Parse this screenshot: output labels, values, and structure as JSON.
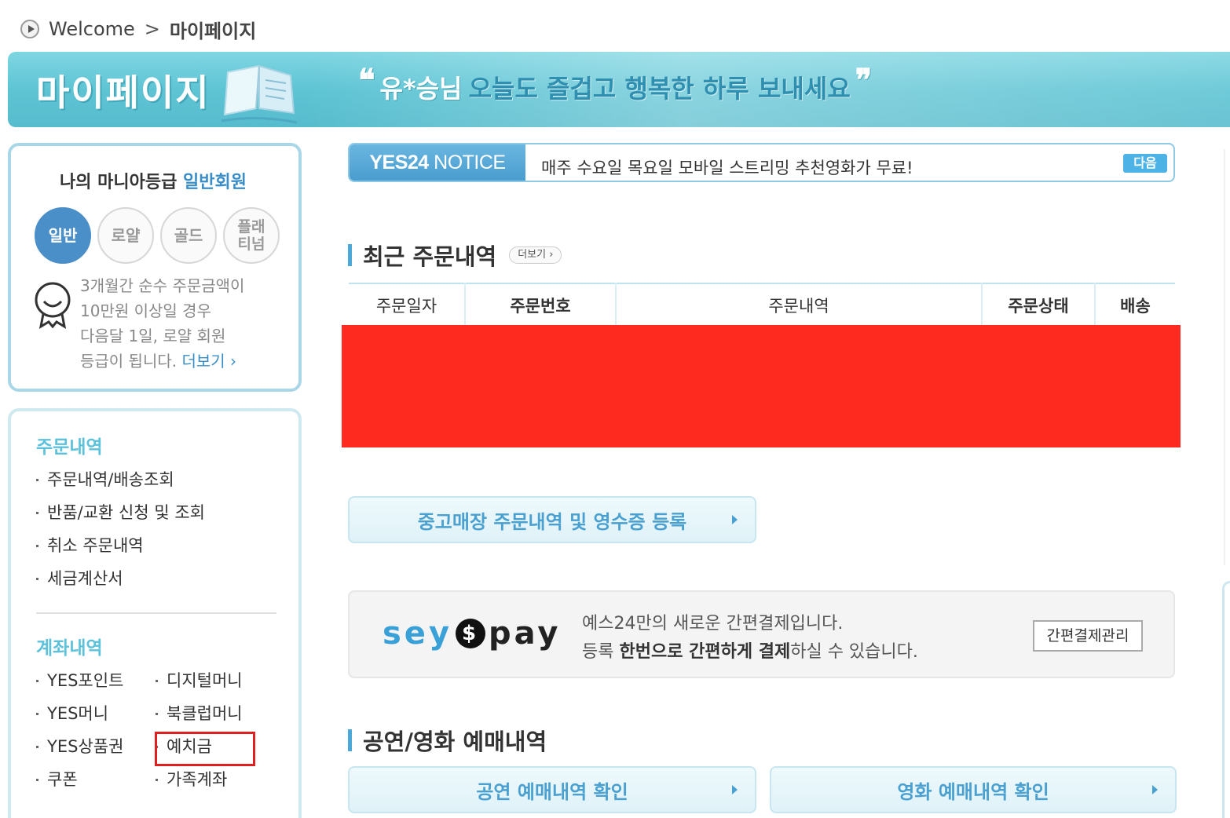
{
  "breadcrumb": {
    "home": "Welcome",
    "separator": ">",
    "current": "마이페이지"
  },
  "banner": {
    "title": "마이페이지",
    "quote_open": "❝",
    "quote_close": "❞",
    "user": "유*승님",
    "message": "오늘도 즐겁고 행복한 하루 보내세요"
  },
  "grade": {
    "title": "나의 마니아등급",
    "level": "일반회원",
    "levels": [
      "일반",
      "로얄",
      "골드",
      "플래\n티넘"
    ],
    "desc_lines": [
      "3개월간 순수 주문금액이",
      "10만원 이상일 경우",
      "다음달 1일, 로얄 회원",
      "등급이 됩니다."
    ],
    "more": "더보기 ›"
  },
  "menu": {
    "orders_title": "주문내역",
    "orders": [
      "주문내역/배송조회",
      "반품/교환 신청 및 조회",
      "취소 주문내역",
      "세금계산서"
    ],
    "accounts_title": "계좌내역",
    "accounts": [
      "YES포인트",
      "디지털머니",
      "YES머니",
      "북클럽머니",
      "YES상품권",
      "예치금",
      "쿠폰",
      "가족계좌"
    ]
  },
  "notice": {
    "label_bold": "YES24",
    "label_rest": " NOTICE",
    "text": "매주 수요일 목요일 모바일 스트리밍 추천영화가 무료!",
    "next": "다음"
  },
  "recent_orders": {
    "title": "최근 주문내역",
    "more": "더보기 ›",
    "columns": [
      "주문일자",
      "주문번호",
      "주문내역",
      "주문상태",
      "배송"
    ]
  },
  "used_store_button": "중고매장 주문내역 및 영수증 등록",
  "pay": {
    "logo_left": "sey",
    "logo_mid": "$",
    "logo_right": "pay",
    "line1": "예스24만의 새로운 간편결제입니다.",
    "line2_a": "등록 ",
    "line2_b": "한번으로 간편하게 결제",
    "line2_c": "하실 수 있습니다.",
    "manage": "간편결제관리"
  },
  "booking": {
    "title": "공연/영화 예매내역",
    "concert_button": "공연 예매내역 확인",
    "movie_button": "영화 예매내역 확인"
  },
  "colors": {
    "accent": "#4aa9d8",
    "banner": "#5ec4d4",
    "redacted": "#fe2a20",
    "highlight": "#e02020"
  }
}
